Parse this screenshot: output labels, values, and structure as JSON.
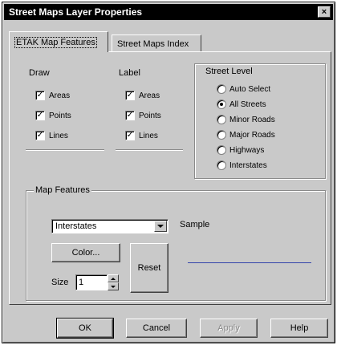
{
  "window": {
    "title": "Street Maps Layer Properties",
    "close_glyph": "×"
  },
  "tabs": [
    {
      "label": "ETAK Map Features",
      "active": true
    },
    {
      "label": "Street Maps Index",
      "active": false
    }
  ],
  "draw": {
    "heading": "Draw",
    "items": [
      {
        "label": "Areas",
        "checked": true
      },
      {
        "label": "Points",
        "checked": true
      },
      {
        "label": "Lines",
        "checked": true
      }
    ]
  },
  "label": {
    "heading": "Label",
    "items": [
      {
        "label": "Areas",
        "checked": true
      },
      {
        "label": "Points",
        "checked": true
      },
      {
        "label": "Lines",
        "checked": true
      }
    ]
  },
  "street_level": {
    "heading": "Street Level",
    "options": [
      {
        "label": "Auto Select",
        "selected": false
      },
      {
        "label": "All Streets",
        "selected": true
      },
      {
        "label": "Minor Roads",
        "selected": false
      },
      {
        "label": "Major Roads",
        "selected": false
      },
      {
        "label": "Highways",
        "selected": false
      },
      {
        "label": "Interstates",
        "selected": false
      }
    ]
  },
  "map_features": {
    "heading": "Map Features",
    "selected_feature": "Interstates",
    "sample_label": "Sample",
    "sample_color": "#3344aa",
    "color_button": "Color...",
    "reset_button": "Reset",
    "size_label": "Size",
    "size_value": "1"
  },
  "footer": {
    "ok": "OK",
    "cancel": "Cancel",
    "apply": "Apply",
    "help": "Help"
  },
  "check_glyph": "✓"
}
